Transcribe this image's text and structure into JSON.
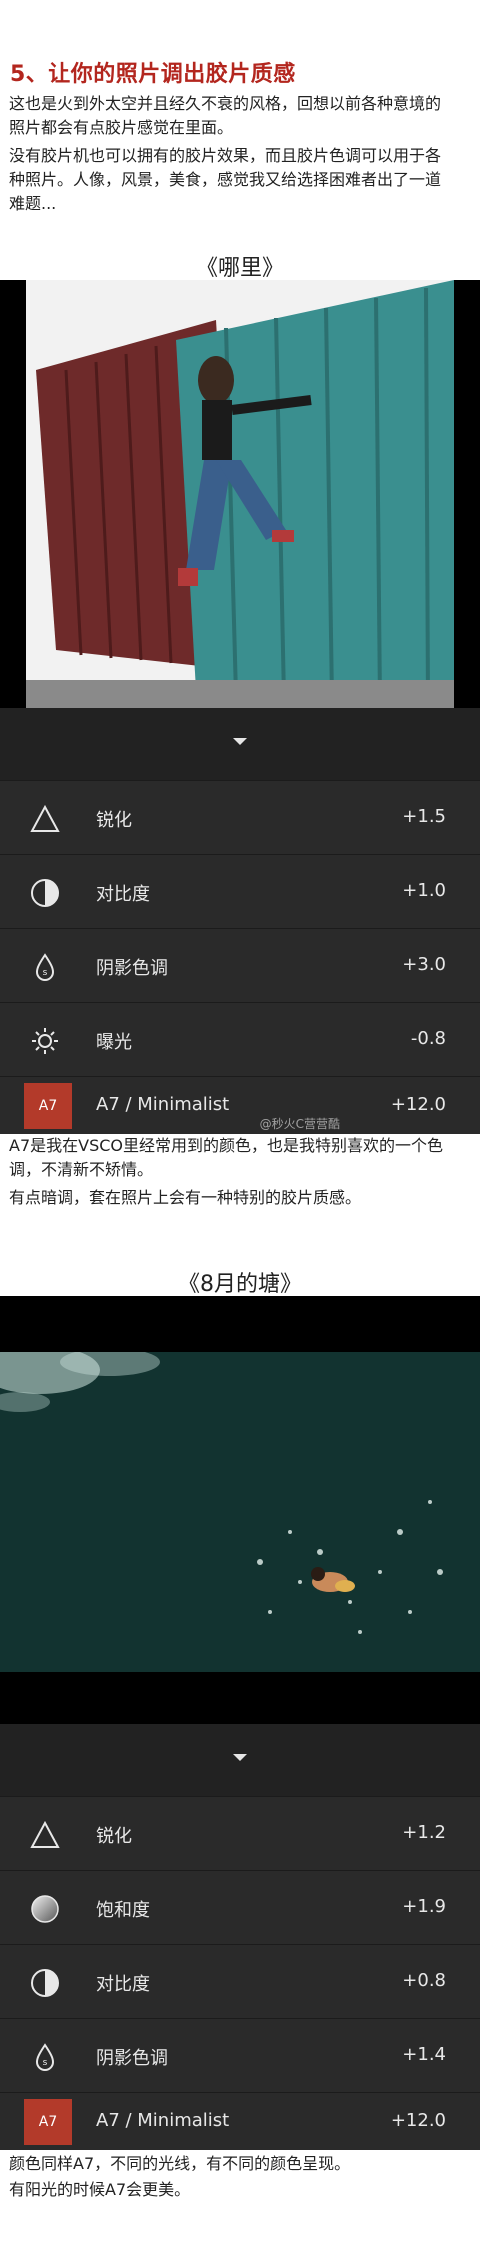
{
  "article": {
    "title": "5、让你的照片调出胶片质感",
    "intro1": "这也是火到外太空并且经久不衰的风格，回想以前各种意境的\n照片都会有点胶片感觉在里面。",
    "intro2": "没有胶片机也可以拥有的胶片效果，而且胶片色调可以用于各\n种照片。人像，风景，美食，感觉我又给选择困难者出了一道\n难题..."
  },
  "example1": {
    "caption": "《哪里》",
    "watermark": "@秒火C营营酷",
    "rows": [
      {
        "label": "锐化",
        "value": "+1.5",
        "icon": "triangle-icon"
      },
      {
        "label": "对比度",
        "value": "+1.0",
        "icon": "contrast-icon"
      },
      {
        "label": "阴影色调",
        "value": "+3.0",
        "icon": "shadow-drop-icon"
      },
      {
        "label": "曝光",
        "value": "-0.8",
        "icon": "sun-icon"
      }
    ],
    "preset": {
      "badge": "A7",
      "name": "A7 / Minimalist",
      "value": "+12.0"
    },
    "note1": "A7是我在VSCO里经常用到的颜色，也是我特别喜欢的一个色\n调，不清新不矫情。",
    "note2": "有点暗调，套在照片上会有一种特别的胶片质感。"
  },
  "example2": {
    "caption": "《8月的塘》",
    "rows": [
      {
        "label": "锐化",
        "value": "+1.2",
        "icon": "triangle-icon"
      },
      {
        "label": "饱和度",
        "value": "+1.9",
        "icon": "saturation-icon"
      },
      {
        "label": "对比度",
        "value": "+0.8",
        "icon": "contrast-icon"
      },
      {
        "label": "阴影色调",
        "value": "+1.4",
        "icon": "shadow-drop-icon"
      }
    ],
    "preset": {
      "badge": "A7",
      "name": "A7 / Minimalist",
      "value": "+12.0"
    },
    "note1": "颜色同样A7，不同的光线，有不同的颜色呈现。",
    "note2": "有阳光的时候A7会更美。"
  },
  "colors": {
    "title": "#b3261e",
    "panel": "#2a2a2a",
    "badge": "#b33a2a"
  }
}
